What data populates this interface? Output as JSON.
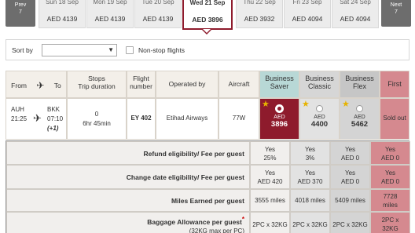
{
  "date_nav": {
    "prev": {
      "label": "Prev",
      "count": "7"
    },
    "next": {
      "label": "Next",
      "count": "7"
    },
    "dates": [
      {
        "label": "Sun 18 Sep",
        "price": "AED 4139",
        "active": false
      },
      {
        "label": "Mon 19 Sep",
        "price": "AED 4139",
        "active": false
      },
      {
        "label": "Tue 20 Sep",
        "price": "AED 4139",
        "active": false
      },
      {
        "label": "Wed 21 Sep",
        "price": "AED 3896",
        "active": true
      },
      {
        "label": "Thu 22 Sep",
        "price": "AED 3932",
        "active": false
      },
      {
        "label": "Fri 23 Sep",
        "price": "AED 4094",
        "active": false
      },
      {
        "label": "Sat 24 Sep",
        "price": "AED 4094",
        "active": false
      }
    ]
  },
  "sort": {
    "label": "Sort by",
    "selected": "",
    "nonstop_label": "Non-stop flights",
    "nonstop_checked": false
  },
  "headers": {
    "from": "From",
    "to": "To",
    "stops_line1": "Stops",
    "stops_line2": "Trip duration",
    "flight_line1": "Flight",
    "flight_line2": "number",
    "operated_by": "Operated by",
    "aircraft": "Aircraft",
    "saver_line1": "Business",
    "saver_line2": "Saver",
    "classic_line1": "Business",
    "classic_line2": "Classic",
    "flex_line1": "Business",
    "flex_line2": "Flex",
    "first": "First"
  },
  "flight": {
    "origin": "AUH",
    "depart": "21:25",
    "destination": "BKK",
    "arrive": "07:10",
    "day_offset": "(+1)",
    "stops": "0",
    "duration": "6hr 45min",
    "flight_number": "EY 402",
    "operator": "Etihad Airways",
    "aircraft": "77W",
    "fares": {
      "saver": {
        "currency": "AED",
        "amount": "3896",
        "selected": true
      },
      "classic": {
        "currency": "AED",
        "amount": "4400",
        "selected": false
      },
      "flex": {
        "currency": "AED",
        "amount": "5462",
        "selected": false
      },
      "first": {
        "status": "Sold out"
      }
    }
  },
  "conditions": [
    {
      "label": "Refund eligibility/ Fee per guest",
      "saver": [
        "Yes",
        "25%"
      ],
      "classic": [
        "Yes",
        "3%"
      ],
      "flex": [
        "Yes",
        "AED 0"
      ],
      "first": [
        "Yes",
        "AED 0"
      ]
    },
    {
      "label": "Change date eligibility/ Fee per guest",
      "saver": [
        "Yes",
        "AED 420"
      ],
      "classic": [
        "Yes",
        "AED 370"
      ],
      "flex": [
        "Yes",
        "AED 0"
      ],
      "first": [
        "Yes",
        "AED 0"
      ]
    },
    {
      "label": "Miles Earned per guest",
      "saver": [
        "3555 miles",
        ""
      ],
      "classic": [
        "4018 miles",
        ""
      ],
      "flex": [
        "5409 miles",
        ""
      ],
      "first": [
        "7728",
        "miles"
      ]
    },
    {
      "label": "Baggage Allowance per guest",
      "required_mark": "*",
      "sublabel": "(32KG max per PC)",
      "saver": [
        "2PC x 32KG",
        ""
      ],
      "classic": [
        "2PC x 32KG",
        ""
      ],
      "flex": [
        "2PC x 32KG",
        ""
      ],
      "first": [
        "2PC x",
        "32KG"
      ]
    }
  ],
  "colors": {
    "accent": "#8e1b2c",
    "first_class": "#d5898f",
    "header_bg": "#f3efe9",
    "star": "#e6b300"
  }
}
